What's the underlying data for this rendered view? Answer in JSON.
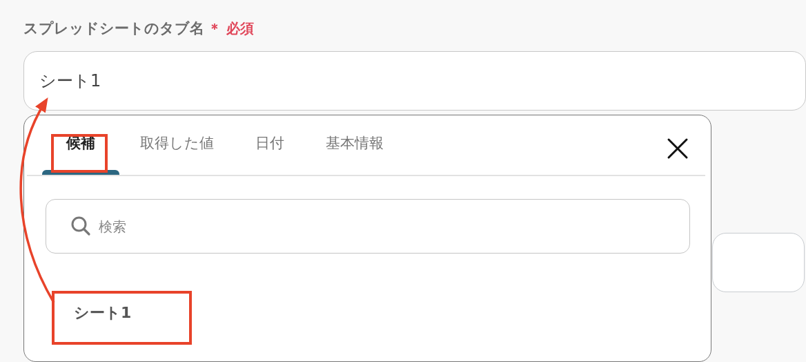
{
  "field_label": {
    "text": "スプレッドシートのタブ名",
    "required_mark": "＊",
    "required_text": "必須"
  },
  "tab_name_field": {
    "value": "シート1"
  },
  "picker": {
    "tabs": [
      {
        "label": "候補",
        "selected": true
      },
      {
        "label": "取得した値",
        "selected": false
      },
      {
        "label": "日付",
        "selected": false
      },
      {
        "label": "基本情報",
        "selected": false
      }
    ],
    "search": {
      "placeholder": "検索"
    },
    "options": [
      {
        "label": "シート1"
      }
    ]
  },
  "annotations": [
    {
      "kind": "frame"
    },
    {
      "kind": "frame"
    },
    {
      "kind": "arrow"
    }
  ]
}
